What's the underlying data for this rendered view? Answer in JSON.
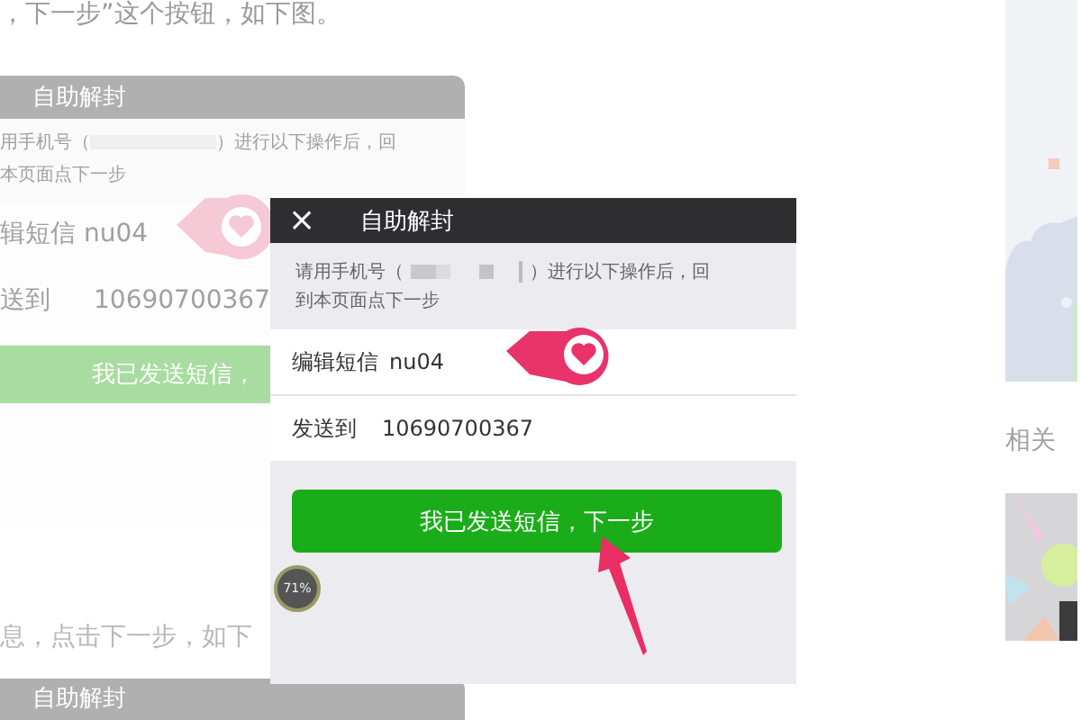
{
  "article": {
    "text_top": "，下一步”这个按钮，如下图。",
    "text_bottom": "息，点击下一步，如下"
  },
  "background_screenshot": {
    "title": "自助解封",
    "instruction_line_1_start": "用手机号（",
    "instruction_line_1_end": "）进行以下操作后，回",
    "instruction_line_2": "本页面点下一步",
    "message_row": "辑短信 nu04",
    "send_label": "送到",
    "send_number": "10690700367",
    "button": "我已发送短信，",
    "next_title": "自助解封"
  },
  "popup_screenshot": {
    "title": "自助解封",
    "close": "×",
    "instruction_line_1_start": "请用手机号（",
    "instruction_line_1_end": "）进行以下操作后，回",
    "instruction_line_2": "到本页面点下一步",
    "rows": [
      {
        "label": "编辑短信",
        "value": "nu04"
      },
      {
        "label": "发送到",
        "value": "10690700367"
      }
    ],
    "button": "我已发送短信，下一步",
    "progress_badge": "71%"
  },
  "sidebar": {
    "heading": "相关"
  }
}
